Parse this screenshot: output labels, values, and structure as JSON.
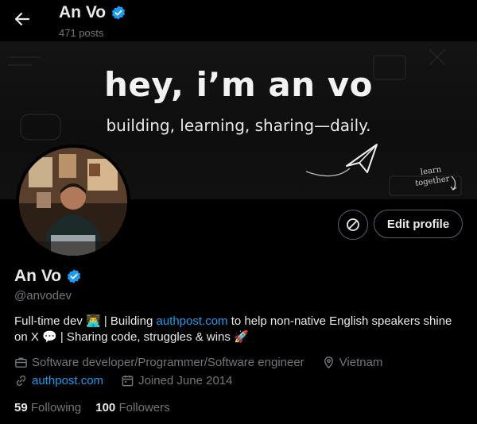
{
  "header": {
    "name": "An Vo",
    "posts": "471 posts"
  },
  "banner": {
    "headline": "hey, i’m an vo",
    "subline": "building, learning, sharing—daily.",
    "note_line1": "learn",
    "note_line2": "together"
  },
  "profile": {
    "name": "An Vo",
    "handle": "@anvodev",
    "edit_label": "Edit profile",
    "bio_part1": "Full-time dev 👨‍💻 | Building ",
    "bio_link": "authpost.com",
    "bio_part2": " to help non-native English speakers shine on X 💬 | Sharing code, struggles & wins 🚀",
    "category": "Software developer/Programmer/Software engineer",
    "location": "Vietnam",
    "website": "authpost.com",
    "joined": "Joined June 2014",
    "following_count": "59",
    "following_label": "Following",
    "followers_count": "100",
    "followers_label": "Followers"
  },
  "colors": {
    "accent": "#1d9bf0",
    "verified": "#1d9bf0",
    "muted": "#71767b",
    "border": "#536471"
  },
  "icons": [
    "back-arrow-icon",
    "verified-badge-icon",
    "paper-plane-icon",
    "subscription-icon",
    "briefcase-icon",
    "location-pin-icon",
    "link-icon",
    "calendar-icon"
  ]
}
